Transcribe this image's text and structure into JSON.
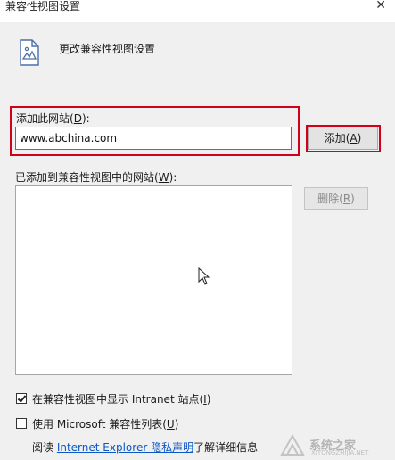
{
  "window": {
    "title": "兼容性视图设置",
    "close_glyph": "✕"
  },
  "header": {
    "icon": "document-icon",
    "text": "更改兼容性视图设置"
  },
  "add_site": {
    "label_prefix": "添加此网站(",
    "label_key": "D",
    "label_suffix": "):",
    "value": "www.abchina.com",
    "button_prefix": "添加(",
    "button_key": "A",
    "button_suffix": ")"
  },
  "site_list": {
    "label_prefix": "已添加到兼容性视图中的网站(",
    "label_key": "W",
    "label_suffix": "):",
    "items": [],
    "remove_prefix": "删除(",
    "remove_key": "R",
    "remove_suffix": ")"
  },
  "options": {
    "intranet": {
      "prefix": "在兼容性视图中显示 Intranet 站点(",
      "key": "I",
      "suffix": ")",
      "checked": true
    },
    "ms_list": {
      "prefix": "使用 Microsoft 兼容性列表(",
      "key": "U",
      "suffix": ")",
      "checked": false
    }
  },
  "footer": {
    "prefix": "阅读 ",
    "link": "Internet Explorer 隐私声明",
    "suffix": "了解详细信息"
  },
  "watermark": {
    "text": "系统之家",
    "url": "XITONGZHIJIA.NET"
  },
  "colors": {
    "highlight_frame": "#d0021b",
    "input_focus": "#2b7bd6",
    "link": "#0b57c4"
  }
}
